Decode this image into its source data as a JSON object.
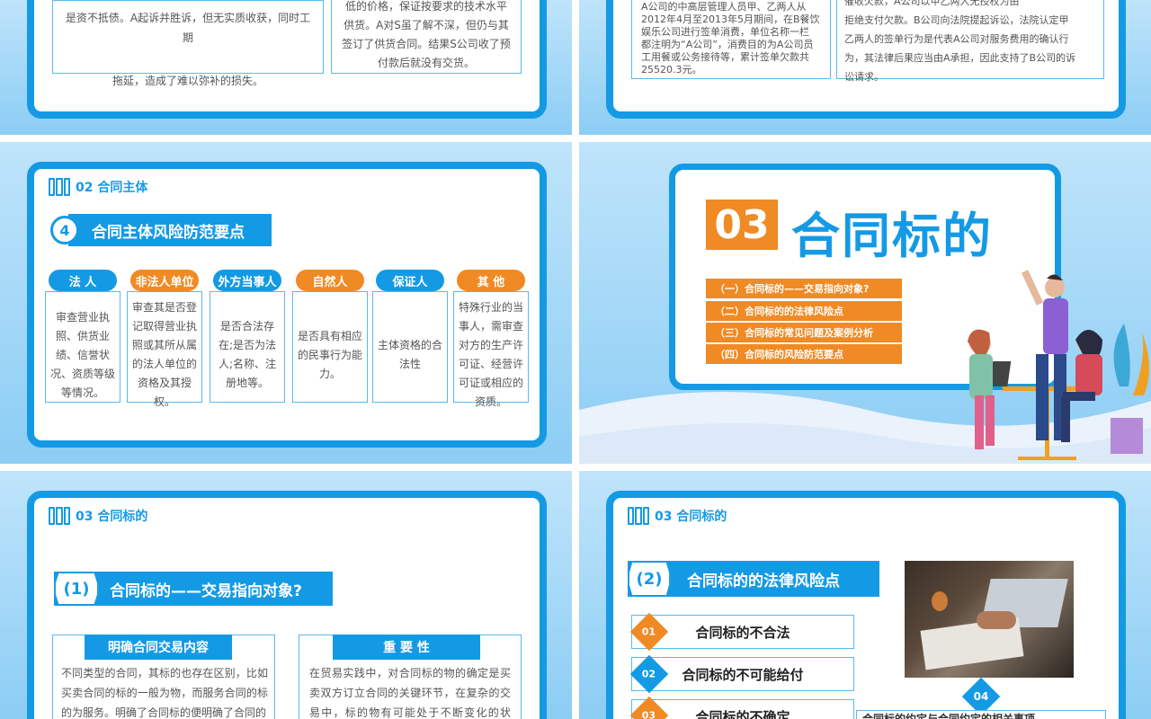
{
  "slide1": {
    "box_left_text": [
      "是资不抵债。A起诉并胜诉，但无实质收获，同时工期",
      "拖延，造成了难以弥补的损失。"
    ],
    "box_right_text": [
      "低的价格，保证按要求的技术水平",
      "供货。A对S虽了解不深，但仍与其",
      "签订了供货合同。结果S公司收了预",
      "付款后就没有交货。"
    ]
  },
  "slide2": {
    "box_left_text": [
      "A公司的中高层管理人员甲、乙两人从",
      "2012年4月至2013年5月期间，在B餐饮",
      "娱乐公司进行签单消费，单位名称一栏",
      "都注明为“A公司”，消费目的为A公司员",
      "工用餐或公务接待等，累计签单欠款共",
      "25520.3元。"
    ],
    "box_right_text": [
      "催收欠款，A公司以甲乙两人无授权为由",
      "拒绝支付欠款。B公司向法院提起诉讼，法院认定甲",
      "乙两人的签单行为是代表A公司对服务费用的确认行",
      "为，其法律后果应当由A承担，因此支持了B公司的诉",
      "讼请求。"
    ]
  },
  "slide3": {
    "header": "02 合同主体",
    "banner_num": "4",
    "banner_title": "合同主体风险防范要点",
    "columns": [
      {
        "label": "法  人",
        "color": "blue",
        "text": "审查营业执照、供货业绩、信誉状况、资质等级等情况。"
      },
      {
        "label": "非法人单位",
        "color": "orange",
        "text": "审查其是否登记取得营业执照或其所从属的法人单位的资格及其授权。"
      },
      {
        "label": "外方当事人",
        "color": "blue",
        "text": "是否合法存在;是否为法人;名称、注册地等。"
      },
      {
        "label": "自然人",
        "color": "orange",
        "text": "是否具有相应的民事行为能力。"
      },
      {
        "label": "保证人",
        "color": "blue",
        "text": "主体资格的合法性"
      },
      {
        "label": "其  他",
        "color": "orange",
        "text": "特殊行业的当事人，需审查对方的生产许可证、经营许可证或相应的资质。"
      }
    ]
  },
  "slide4": {
    "num": "03",
    "title": "合同标的",
    "menu": [
      "（一）合同标的——交易指向对象?",
      "（二）合同标的的法律风险点",
      "（三）合同标的常见问题及案例分析",
      "（四）合同标的风险防范要点"
    ]
  },
  "slide5": {
    "header": "03 合同标的",
    "banner_num": "(1)",
    "banner_title": "合同标的——交易指向对象?",
    "left_head": "明确合同交易内容",
    "left_text": "不同类型的合同，其标的也存在区别，比如买卖合同的标的一般为物，而服务合同的标的为服务。明确了合同标的便明确了合同的",
    "right_head": "重  要  性",
    "right_text": "在贸易实践中，对合同标的物的确定是买卖双方订立合同的关键环节，在复杂的交易中，标的物有可能处于不断变化的状态，"
  },
  "slide6": {
    "header": "03 合同标的",
    "banner_num": "(2)",
    "banner_title": "合同标的的法律风险点",
    "risks": [
      {
        "num": "01",
        "label": "合同标的不合法",
        "color": "#f08a24"
      },
      {
        "num": "02",
        "label": "合同标的不可能给付",
        "color": "#149ae5"
      },
      {
        "num": "03",
        "label": "合同标的不确定",
        "color": "#f08a24"
      }
    ],
    "badge": "04",
    "badge_text": "合同标的约定与合同约定的相关事项"
  }
}
